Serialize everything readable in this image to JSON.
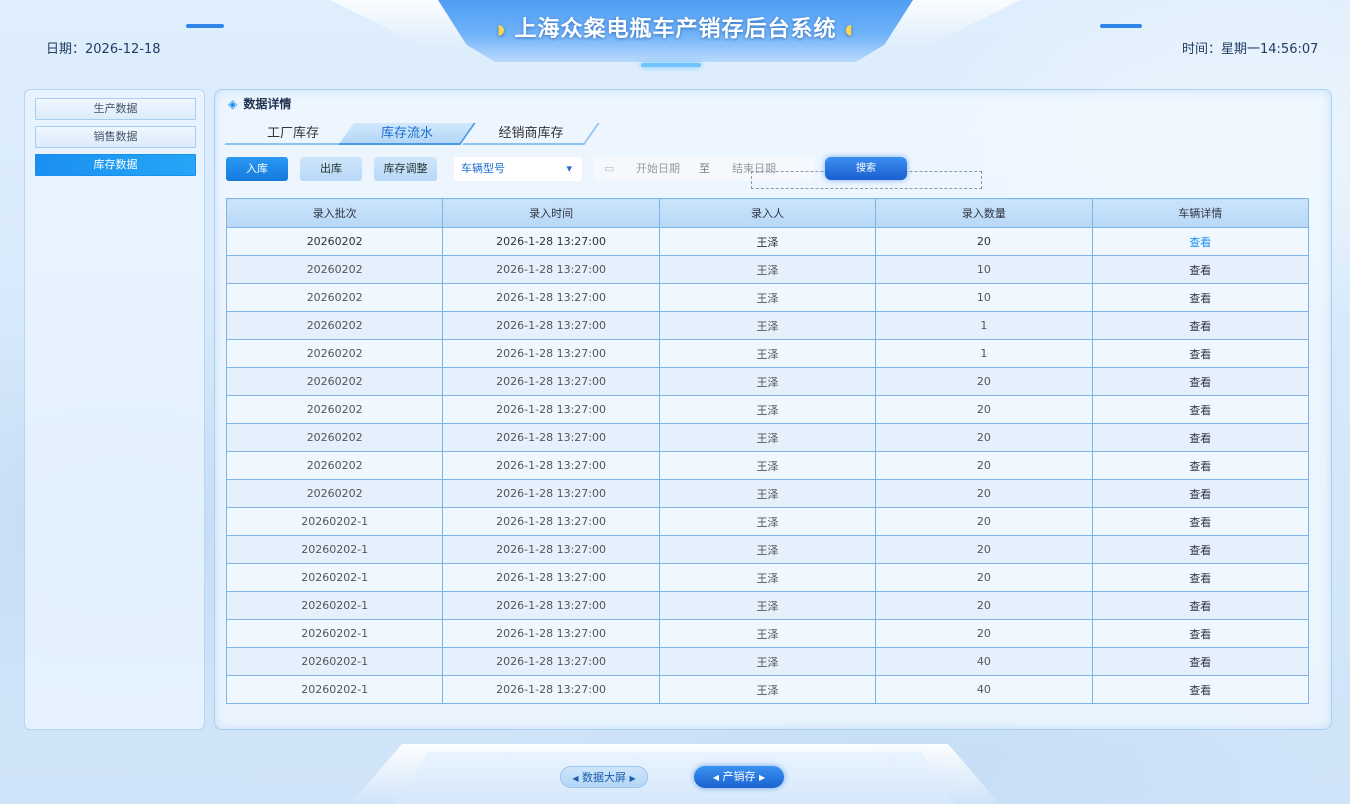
{
  "header": {
    "title": "上海众粲电瓶车产销存后台系统",
    "date_label": "日期：2026-12-18",
    "time_label": "时间：星期一14:56:07"
  },
  "sidebar": {
    "items": [
      {
        "label": "生产数据",
        "active": false
      },
      {
        "label": "销售数据",
        "active": false
      },
      {
        "label": "库存数据",
        "active": true
      }
    ]
  },
  "panel": {
    "title": "数据详情",
    "tabs": [
      {
        "label": "工厂库存",
        "active": false
      },
      {
        "label": "库存流水",
        "active": true
      },
      {
        "label": "经销商库存",
        "active": false
      }
    ]
  },
  "filters": {
    "buttons": [
      {
        "label": "入库",
        "active": true
      },
      {
        "label": "出库",
        "active": false
      },
      {
        "label": "库存调整",
        "active": false
      }
    ],
    "vehicle_select": "车辆型号",
    "start_date_placeholder": "开始日期",
    "range_separator": "至",
    "end_date_placeholder": "结束日期",
    "search_label": "搜索"
  },
  "table": {
    "headers": [
      "录入批次",
      "录入时间",
      "录入人",
      "录入数量",
      "车辆详情"
    ],
    "rows": [
      [
        "20260202",
        "2026-1-28  13:27:00",
        "王泽",
        "20",
        "查看"
      ],
      [
        "20260202",
        "2026-1-28  13:27:00",
        "王泽",
        "10",
        "查看"
      ],
      [
        "20260202",
        "2026-1-28  13:27:00",
        "王泽",
        "10",
        "查看"
      ],
      [
        "20260202",
        "2026-1-28  13:27:00",
        "王泽",
        "1",
        "查看"
      ],
      [
        "20260202",
        "2026-1-28  13:27:00",
        "王泽",
        "1",
        "查看"
      ],
      [
        "20260202",
        "2026-1-28  13:27:00",
        "王泽",
        "20",
        "查看"
      ],
      [
        "20260202",
        "2026-1-28  13:27:00",
        "王泽",
        "20",
        "查看"
      ],
      [
        "20260202",
        "2026-1-28  13:27:00",
        "王泽",
        "20",
        "查看"
      ],
      [
        "20260202",
        "2026-1-28  13:27:00",
        "王泽",
        "20",
        "查看"
      ],
      [
        "20260202",
        "2026-1-28  13:27:00",
        "王泽",
        "20",
        "查看"
      ],
      [
        "20260202-1",
        "2026-1-28  13:27:00",
        "王泽",
        "20",
        "查看"
      ],
      [
        "20260202-1",
        "2026-1-28  13:27:00",
        "王泽",
        "20",
        "查看"
      ],
      [
        "20260202-1",
        "2026-1-28  13:27:00",
        "王泽",
        "20",
        "查看"
      ],
      [
        "20260202-1",
        "2026-1-28  13:27:00",
        "王泽",
        "20",
        "查看"
      ],
      [
        "20260202-1",
        "2026-1-28  13:27:00",
        "王泽",
        "20",
        "查看"
      ],
      [
        "20260202-1",
        "2026-1-28  13:27:00",
        "王泽",
        "40",
        "查看"
      ],
      [
        "20260202-1",
        "2026-1-28  13:27:00",
        "王泽",
        "40",
        "查看"
      ]
    ]
  },
  "bottom_nav": {
    "items": [
      {
        "label": "数据大屏",
        "active": false
      },
      {
        "label": "产销存",
        "active": true
      }
    ]
  },
  "colors": {
    "accent": "#1b8ff0",
    "header": "#4f9df3",
    "table_border": "#7fb4e6"
  }
}
